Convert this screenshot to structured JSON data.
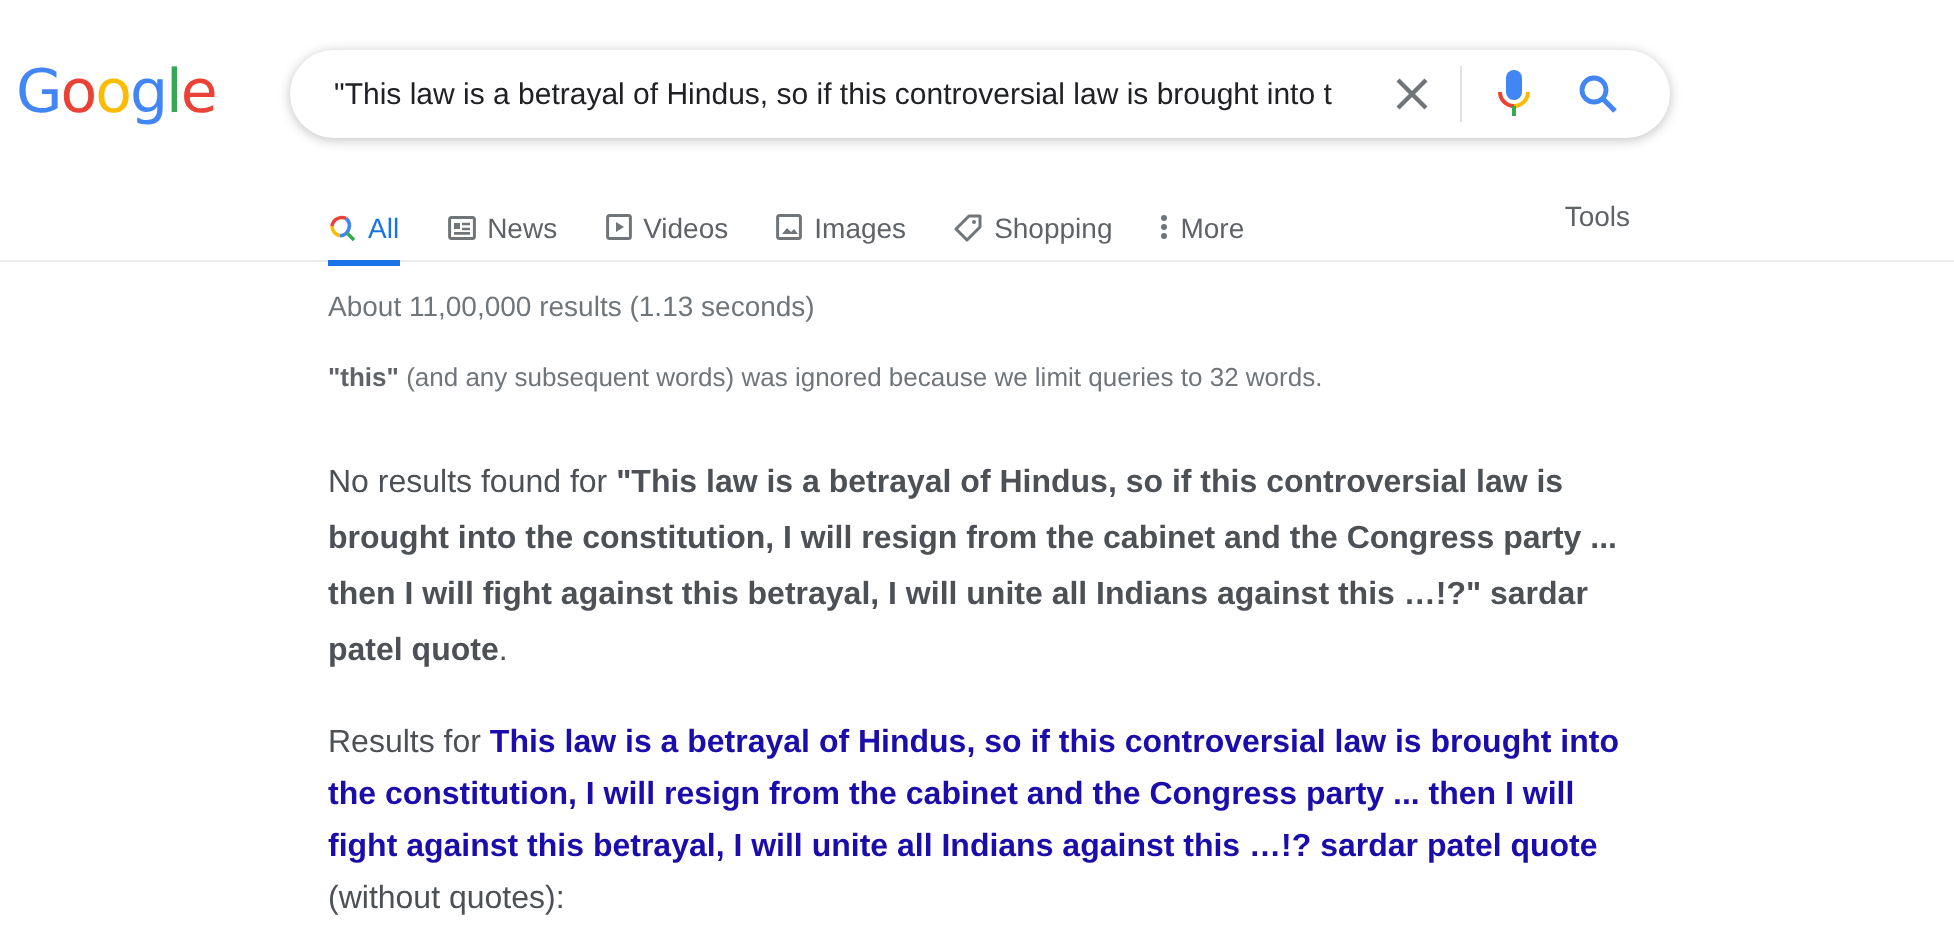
{
  "logo": "Google",
  "search": {
    "value": "\"This law is a betrayal of Hindus, so if this controversial law is brought into t"
  },
  "tabs": [
    {
      "label": "All",
      "kind": "search",
      "selected": true
    },
    {
      "label": "News",
      "kind": "news",
      "selected": false
    },
    {
      "label": "Videos",
      "kind": "video",
      "selected": false
    },
    {
      "label": "Images",
      "kind": "image",
      "selected": false
    },
    {
      "label": "Shopping",
      "kind": "tag",
      "selected": false
    },
    {
      "label": "More",
      "kind": "more",
      "selected": false
    }
  ],
  "tools": "Tools",
  "result_stats": "About 11,00,000 results (1.13 seconds)",
  "ignored_notice": "**\"this\"** (and any subsequent words) was ignored because we limit queries to 32 words.",
  "no_results": "No results found for **\"This law is a betrayal of Hindus, so if this controversial law is brought into the constitution, I will resign from the cabinet and the Congress party ... then I will fight against this betrayal, I will unite all Indians against this …!?\" sardar patel quote**.",
  "results_for": "Results for **This law is a betrayal of Hindus, so if this controversial law is brought into the constitution, I will resign from the cabinet and the Congress party ... then I will fight against this betrayal, I will unite all Indians against this …!? sardar patel quote** (without quotes):"
}
